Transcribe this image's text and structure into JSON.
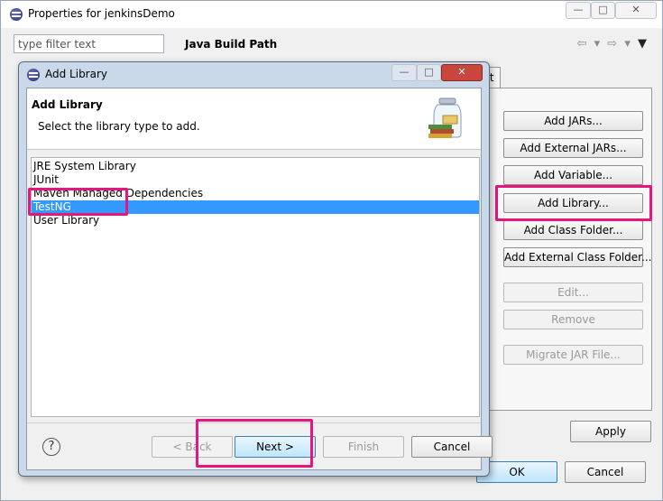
{
  "window": {
    "title": "Properties for jenkinsDemo",
    "caption_buttons": [
      "—",
      "□",
      "✕"
    ]
  },
  "filter": {
    "placeholder": "type filter text"
  },
  "page": {
    "title": "Java Build Path",
    "nav_back": "⇦ ▾",
    "nav_fwd": "⇨ ▾",
    "nav_menu": "▼",
    "partial_tab_label": "rt"
  },
  "side_buttons": {
    "add_jars": "Add JARs...",
    "add_external_jars": "Add External JARs...",
    "add_variable": "Add Variable...",
    "add_library": "Add Library...",
    "add_class_folder": "Add Class Folder...",
    "add_external_class_folder": "Add External Class Folder...",
    "edit": "Edit...",
    "remove": "Remove",
    "migrate_jar": "Migrate JAR File..."
  },
  "bottom_buttons": {
    "apply": "Apply",
    "ok": "OK",
    "cancel": "Cancel"
  },
  "dialog": {
    "title": "Add Library",
    "heading": "Add Library",
    "description": "Select the library type to add.",
    "libraries": [
      {
        "label": "JRE System Library",
        "selected": false
      },
      {
        "label": "JUnit",
        "selected": false
      },
      {
        "label": "Maven Managed Dependencies",
        "selected": false
      },
      {
        "label": "TestNG",
        "selected": true
      },
      {
        "label": "User Library",
        "selected": false
      }
    ],
    "help_icon": "?",
    "back": "< Back",
    "next": "Next >",
    "finish": "Finish",
    "cancel": "Cancel"
  },
  "colors": {
    "highlight": "#e5167d",
    "selection": "#3399ff",
    "dialog_frame": "#c9d9ea"
  }
}
